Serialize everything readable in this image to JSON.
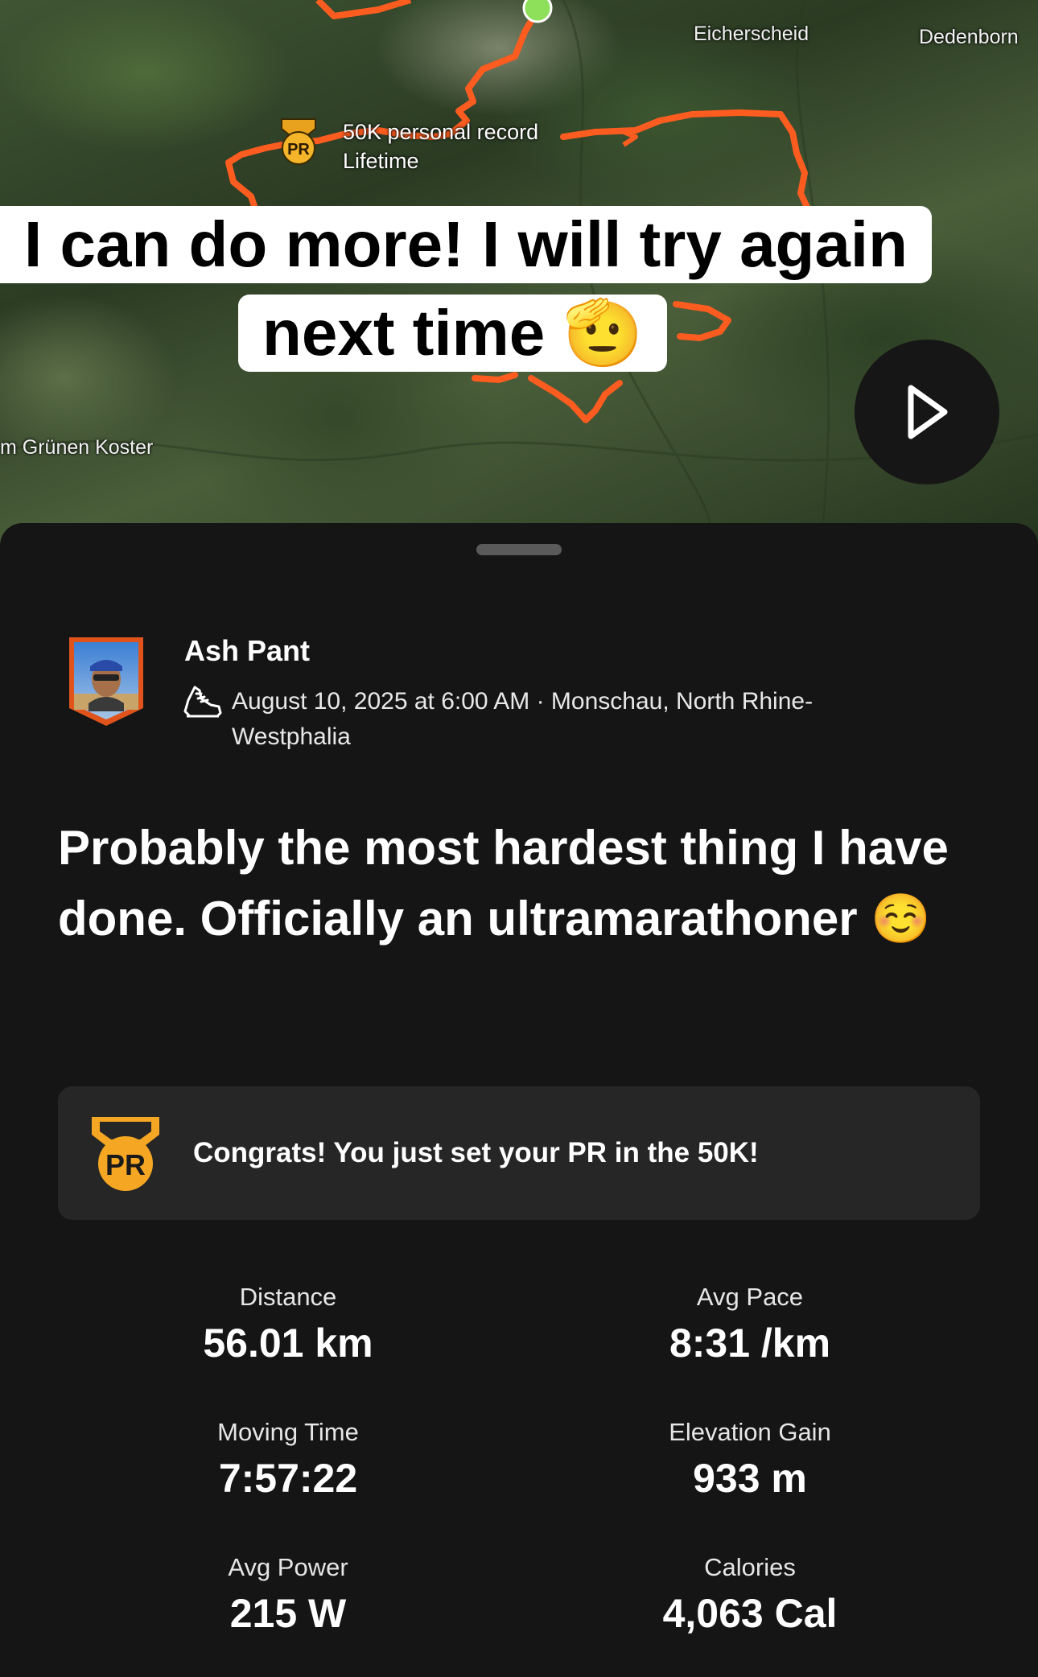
{
  "map": {
    "labels": {
      "eicherscheid": "Eicherscheid",
      "dedenborn": "Dedenborn",
      "gruenen_koster": "m Grünen Koster"
    },
    "pr_marker": {
      "badge_text": "PR",
      "line1": "50K personal record",
      "line2": "Lifetime"
    },
    "caption": {
      "line1": "I can do more! I will try again",
      "line2": "next time 🫡"
    },
    "route_color": "#fc5c1f",
    "start_dot_color": "#8ee05a"
  },
  "activity": {
    "athlete_name": "Ash Pant",
    "sport_icon": "shoe-icon",
    "date_location": "August 10, 2025 at 6:00 AM · Monschau, North Rhine-Westphalia",
    "title": "Probably the most hardest thing I have done. Officially an ultramarathoner ☺️"
  },
  "pr_card": {
    "badge_text": "PR",
    "message": "Congrats! You just set your PR in the 50K!",
    "medal_color": "#f5a623"
  },
  "stats": [
    {
      "label": "Distance",
      "value": "56.01 km"
    },
    {
      "label": "Avg Pace",
      "value": "8:31 /km"
    },
    {
      "label": "Moving Time",
      "value": "7:57:22"
    },
    {
      "label": "Elevation Gain",
      "value": "933 m"
    },
    {
      "label": "Avg Power",
      "value": "215 W"
    },
    {
      "label": "Calories",
      "value": "4,063 Cal"
    }
  ]
}
